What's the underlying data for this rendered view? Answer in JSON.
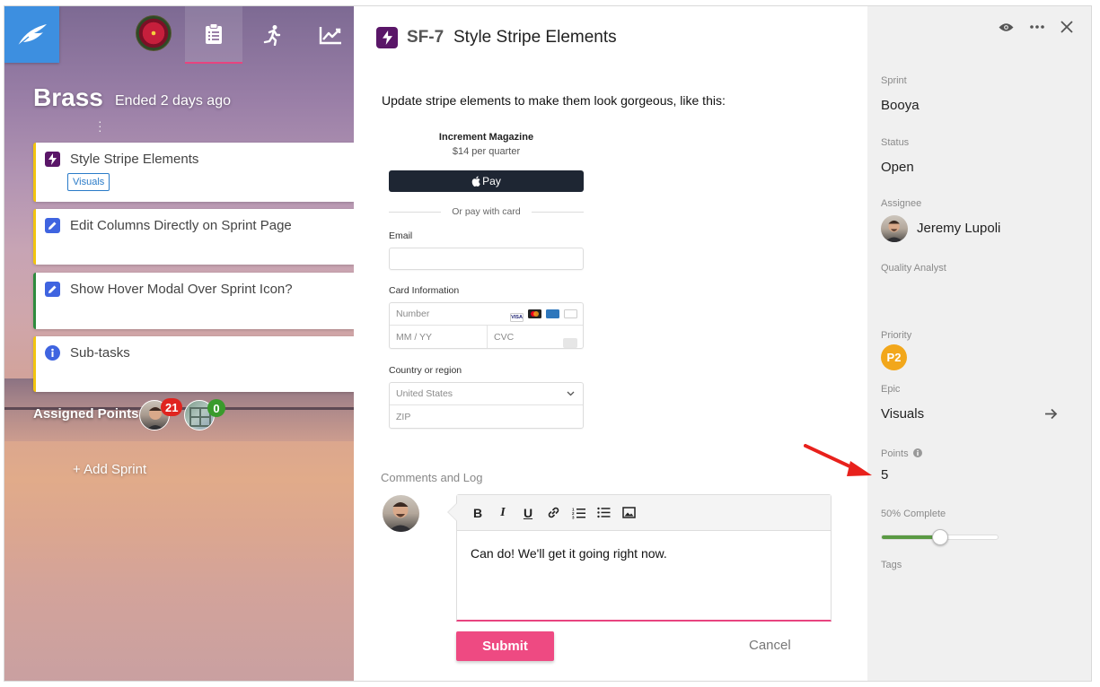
{
  "nav": {
    "tabs": [
      "sprint-board-tab",
      "running-icon-tab",
      "chart-icon-tab"
    ]
  },
  "sprint": {
    "name": "Brass",
    "status": "Ended 2 days ago",
    "cards": [
      {
        "title": "Style Stripe Elements",
        "icon": "lightning-icon",
        "tag": "Visuals",
        "border_color": "#f1c40f"
      },
      {
        "title": "Edit Columns Directly on Sprint Page",
        "icon": "pencil-icon",
        "border_color": "#f1c40f"
      },
      {
        "title": "Show Hover Modal Over Sprint Icon?",
        "icon": "pencil-icon",
        "border_color": "#2e8b3e"
      },
      {
        "title": "Sub-tasks",
        "icon": "info-icon",
        "border_color": "#f1c40f"
      }
    ],
    "assigned_label": "Assigned Points:",
    "assignees": [
      {
        "points": "21",
        "badge_color": "#e0241f"
      },
      {
        "points": "0",
        "badge_color": "#3a9b2c"
      }
    ],
    "add_sprint": "+ Add Sprint"
  },
  "issue": {
    "key": "SF-7",
    "title": "Style Stripe Elements",
    "description": "Update stripe elements to make them look gorgeous, like this:",
    "payment_form": {
      "merchant": "Increment Magazine",
      "price": "$14 per quarter",
      "apple_pay": "Pay",
      "divider": "Or pay with card",
      "email_label": "Email",
      "card_label": "Card Information",
      "card_number_placeholder": "Number",
      "expiry_placeholder": "MM / YY",
      "cvc_placeholder": "CVC",
      "country_label": "Country or region",
      "country_value": "United States",
      "zip_placeholder": "ZIP"
    },
    "comments_label": "Comments and Log",
    "comment_text": "Can do!  We'll get it going right now.",
    "submit_label": "Submit",
    "cancel_label": "Cancel"
  },
  "sidebar": {
    "sprint_label": "Sprint",
    "sprint_value": "Booya",
    "status_label": "Status",
    "status_value": "Open",
    "assignee_label": "Assignee",
    "assignee_value": "Jeremy Lupoli",
    "qa_label": "Quality Analyst",
    "priority_label": "Priority",
    "priority_value": "P2",
    "epic_label": "Epic",
    "epic_value": "Visuals",
    "points_label": "Points",
    "points_value": "5",
    "progress_label": "50% Complete",
    "progress_fraction": 0.5,
    "tags_label": "Tags"
  },
  "colors": {
    "accent": "#e8447f",
    "brand_blue": "#3d8fe0",
    "issue_icon": "#5a1668",
    "priority": "#f2a71b",
    "progress": "#5a9a43"
  }
}
